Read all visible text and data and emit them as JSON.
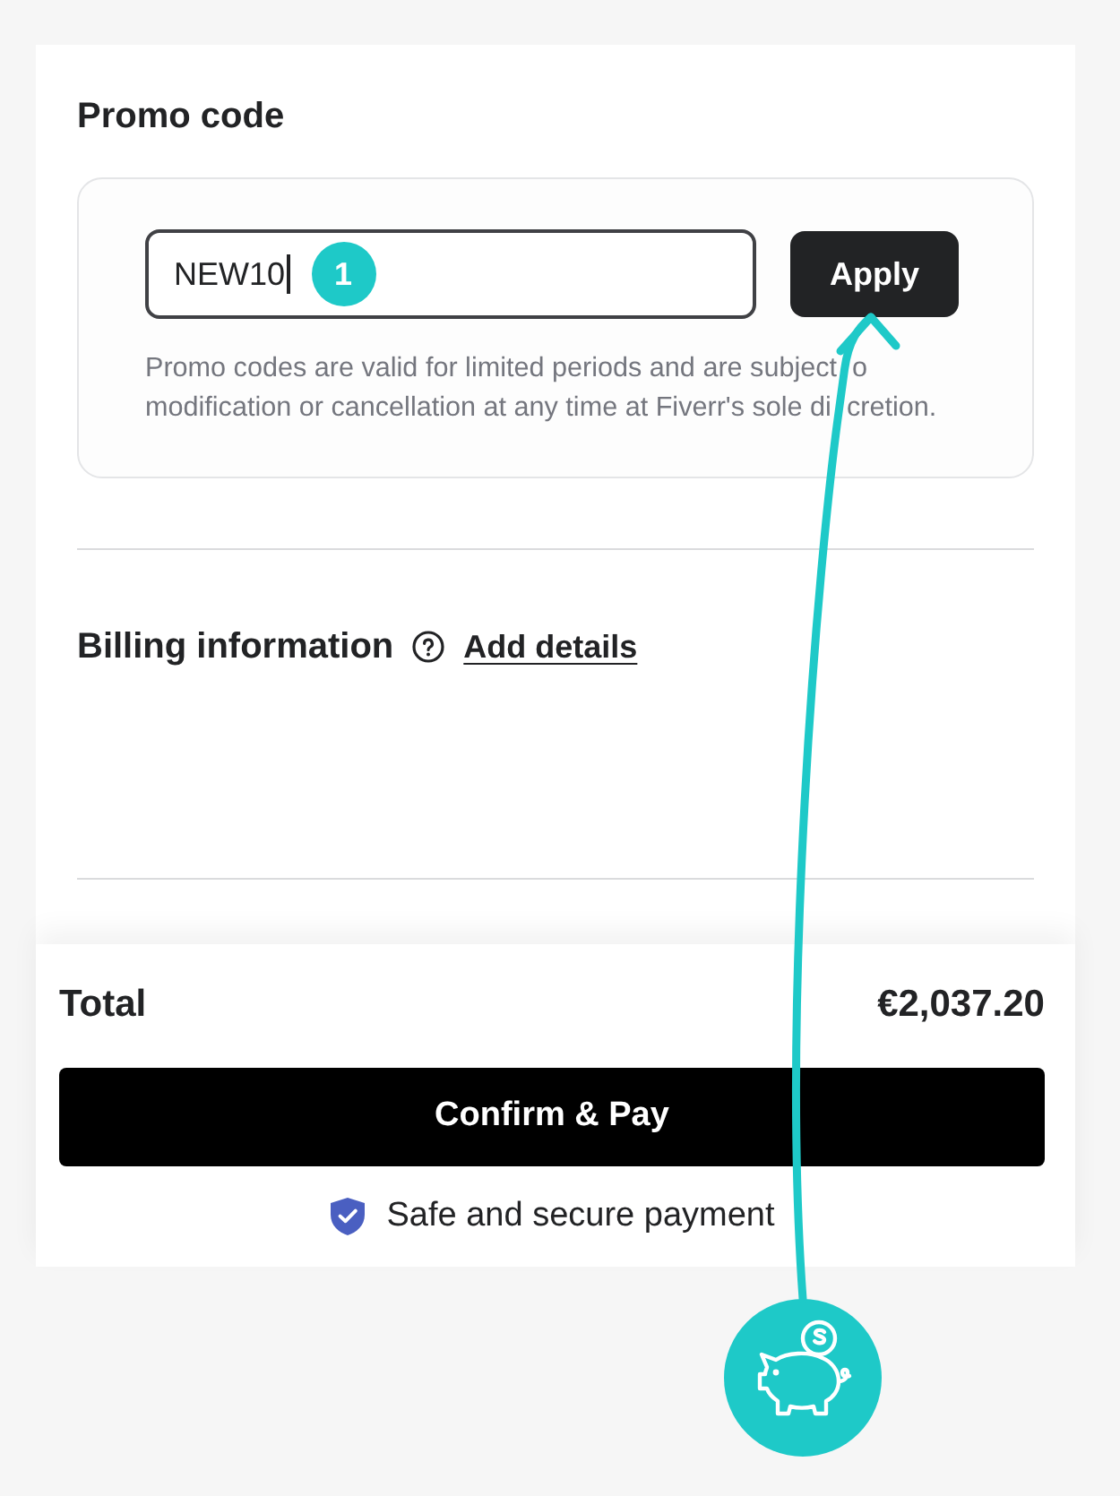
{
  "promo": {
    "title": "Promo code",
    "input": {
      "value": "NEW10",
      "focused": true
    },
    "step_badge": "1",
    "apply_button": "Apply",
    "note": "Promo codes are valid for limited periods and are subject  o modification or cancellation at any time at Fiverr's sole di  cretion."
  },
  "billing": {
    "title": "Billing information",
    "link": "Add details"
  },
  "summary": {
    "total_label": "Total",
    "total_value": "€2,037.20",
    "confirm_button": "Confirm & Pay",
    "secure_note": "Safe and secure payment"
  }
}
